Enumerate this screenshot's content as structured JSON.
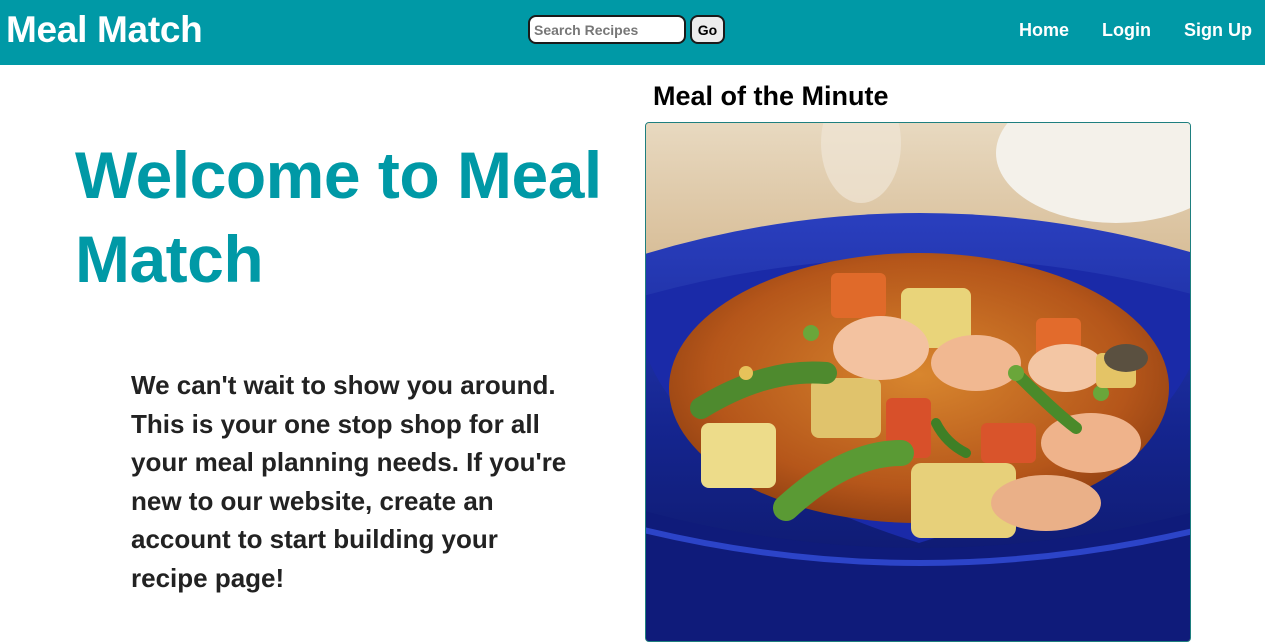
{
  "header": {
    "brand": "Meal Match",
    "search": {
      "placeholder": "Search Recipes",
      "value": "",
      "button_label": "Go"
    },
    "nav": [
      {
        "label": "Home"
      },
      {
        "label": "Login"
      },
      {
        "label": "Sign Up"
      }
    ]
  },
  "main": {
    "title": "Welcome to Meal Match",
    "intro": "We can't wait to show you around. This is your one stop shop for all your meal planning needs. If you're new to our website, create an account to start building your recipe page!"
  },
  "featured": {
    "heading": "Meal of the Minute",
    "image_alt": "stew-bowl-photo"
  },
  "colors": {
    "primary": "#0099a6",
    "text_dark": "#222222",
    "white": "#ffffff"
  }
}
